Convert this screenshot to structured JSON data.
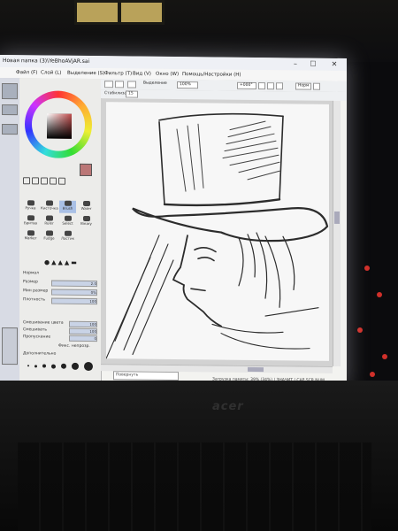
{
  "window": {
    "title": "Новая папка (3)\\YeBhoAVjAR.sai"
  },
  "menu": [
    "Файл (F)",
    "Слой (L)",
    "Выделение (S)",
    "Фильтр (T)",
    "Вид (V)",
    "Окно (W)",
    "Помощь/Настройки (H)"
  ],
  "toolbar": {
    "zoom": "100%",
    "angle": "+000°",
    "normal_label": "Норм",
    "selection_label": "Выделение",
    "stabilizer_label": "Стабилизация",
    "stabilizer_value": "15"
  },
  "tools": {
    "row1": [
      "Ручка",
      "Кисточка",
      "Brush",
      "Water"
    ],
    "row2": [
      "Бритва",
      "Ruler",
      "Select",
      "Binary"
    ],
    "row3": [
      "Marker",
      "Fudge",
      "Ластик",
      ""
    ],
    "properties": [
      {
        "label": "Нормал",
        "value": ""
      },
      {
        "label": "Размер",
        "value": "2.0"
      },
      {
        "label": "Мин размер",
        "value": "0%"
      },
      {
        "label": "Плотность",
        "value": "100"
      },
      {
        "label": "Смешивание цвета",
        "value": "100"
      },
      {
        "label": "Смешивать",
        "value": "100"
      },
      {
        "label": "Пропускание",
        "value": "0"
      }
    ],
    "checkbox_label": "Фикс. непрозр.",
    "adv_label": "Дополнительно"
  },
  "navigator": {
    "label": "Повернуть"
  },
  "status": {
    "text": "Загрузка памяти: 39% (34%)  |  ЗНАЧИТ  |  CAP SCR NUM"
  },
  "bezel": {
    "brand": "acer"
  }
}
